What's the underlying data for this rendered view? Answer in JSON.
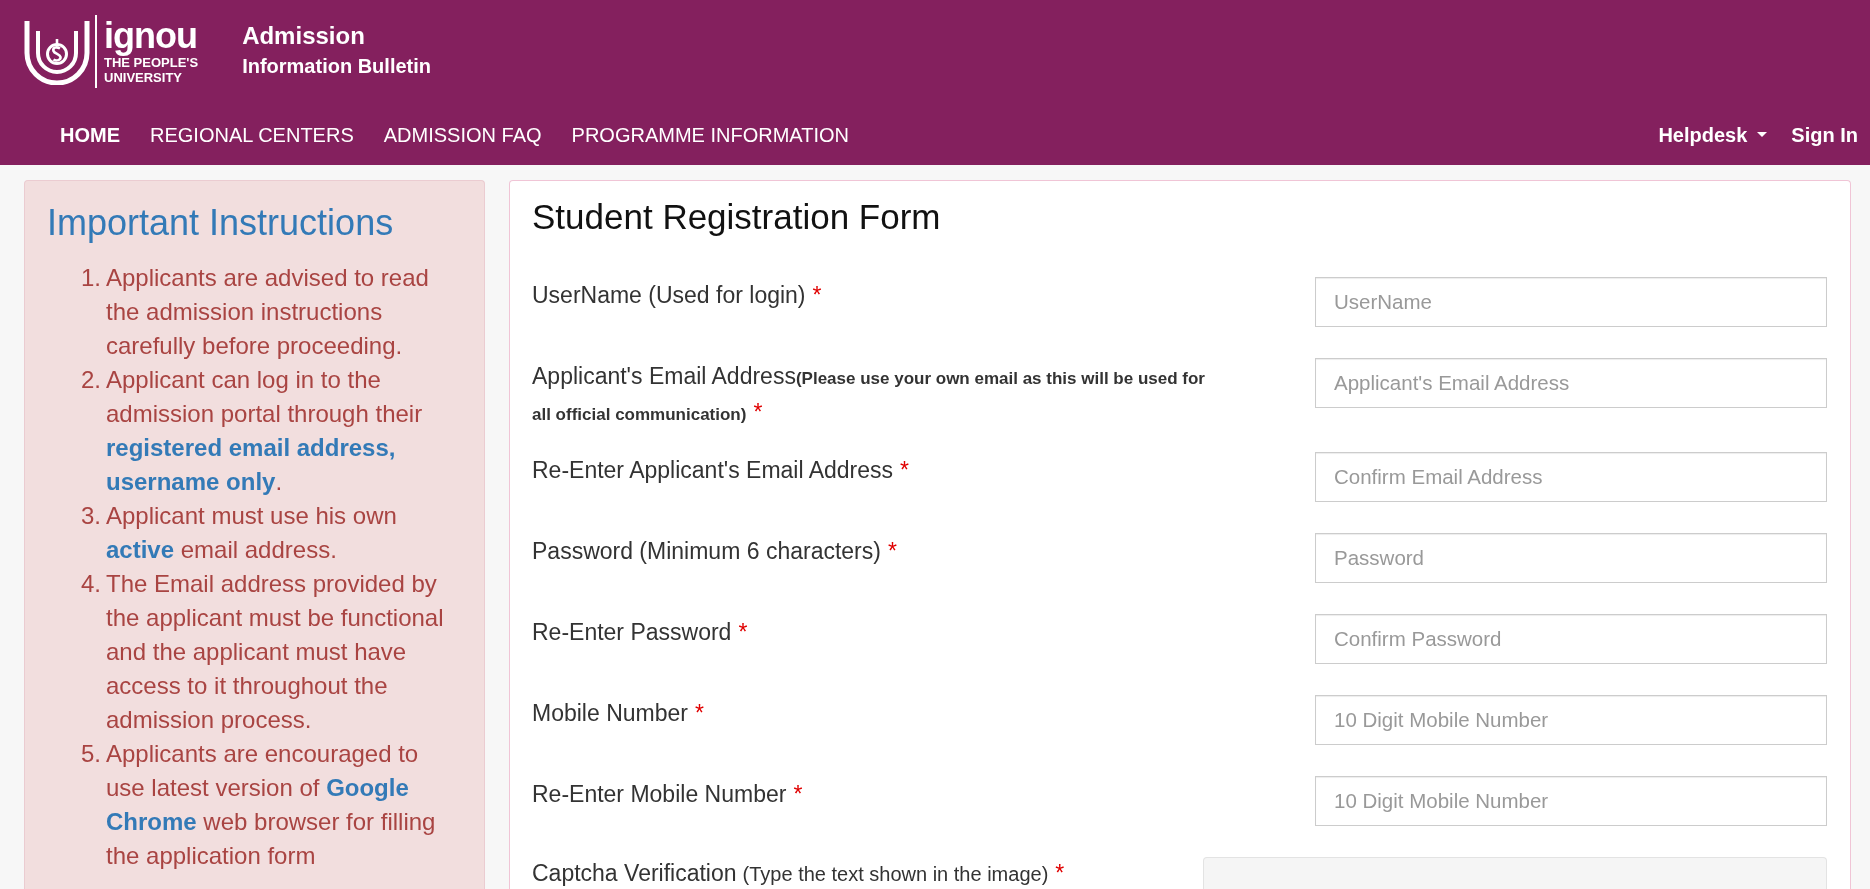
{
  "header": {
    "logo": {
      "wordmark": "ignou",
      "tagline": [
        "THE PEOPLE'S",
        "UNIVERSITY"
      ]
    },
    "title": "Admission",
    "subtitle": "Information Bulletin"
  },
  "nav": {
    "items": [
      {
        "label": "HOME",
        "selected": true
      },
      {
        "label": "REGIONAL CENTERS",
        "selected": false
      },
      {
        "label": "ADMISSION FAQ",
        "selected": false
      },
      {
        "label": "PROGRAMME INFORMATION",
        "selected": false
      }
    ],
    "right": [
      {
        "label": "Helpdesk",
        "kind": "dropdown"
      },
      {
        "label": "Sign In",
        "kind": "link"
      }
    ]
  },
  "instructions": {
    "title": "Important Instructions",
    "items": [
      {
        "number": "1.",
        "text": "Applicants are advised to read the admission instructions carefully before proceeding."
      },
      {
        "number": "2.",
        "text": "Applicant can log in to the admission portal through their **registered email address, username only**."
      },
      {
        "number": "3.",
        "text": "Applicant must use his own **active** email address."
      },
      {
        "number": "4.",
        "text": "The Email address provided by the applicant must be functional and the applicant must have access to it throughout the admission process."
      },
      {
        "number": "5.",
        "text": "Applicants are encouraged to use latest version of **Google Chrome** web browser for filling the application form"
      }
    ]
  },
  "form": {
    "title": "Student Registration Form",
    "fields": [
      {
        "kind": "input",
        "label": "UserName (Used for login)",
        "required_mark": "*",
        "placeholder": "UserName"
      },
      {
        "kind": "input",
        "label": "Applicant's Email Address",
        "note": {
          "text": "(Please use your own email as this will be used for all official communication)",
          "bold": true
        },
        "required_mark": "*",
        "placeholder": "Applicant's Email Address"
      },
      {
        "kind": "input",
        "label": "Re-Enter Applicant's Email Address",
        "required_mark": "*",
        "placeholder": "Confirm Email Address"
      },
      {
        "kind": "input",
        "label": "Password (Minimum 6 characters)",
        "required_mark": "*",
        "placeholder": "Password"
      },
      {
        "kind": "input",
        "label": "Re-Enter Password",
        "required_mark": "*",
        "placeholder": "Confirm Password"
      },
      {
        "kind": "input",
        "label": "Mobile Number",
        "required_mark": "*",
        "placeholder": "10 Digit Mobile Number"
      },
      {
        "kind": "input",
        "label": "Re-Enter Mobile Number",
        "required_mark": "*",
        "placeholder": "10 Digit Mobile Number"
      },
      {
        "kind": "captcha",
        "label": "Captcha Verification",
        "note": {
          "text": "(Type the text shown in the image)",
          "bold": false
        },
        "required_mark": "*"
      }
    ]
  }
}
